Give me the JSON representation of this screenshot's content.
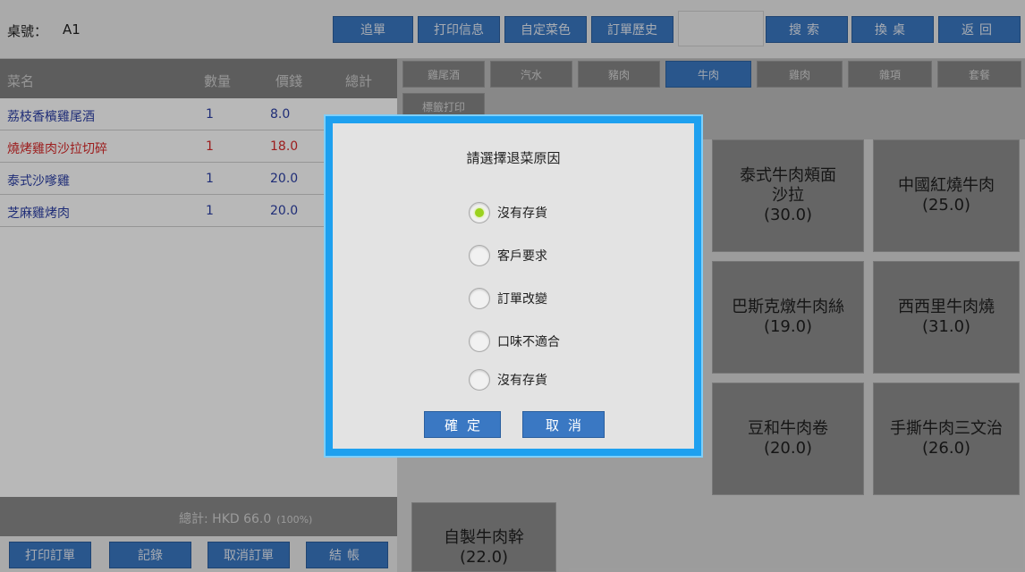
{
  "topbar": {
    "table_label": "桌號：",
    "table_value": "A1",
    "buttons": {
      "add_order": "追單",
      "print_info": "打印信息",
      "custom_color": "自定菜色",
      "order_history": "訂單歷史",
      "search": "搜索",
      "change_table": "換桌",
      "back": "返回"
    },
    "search_value": ""
  },
  "order": {
    "headers": {
      "name": "菜名",
      "qty": "數量",
      "price": "價錢",
      "total": "總計"
    },
    "rows": [
      {
        "name": "荔枝香檳雞尾酒",
        "qty": "1",
        "price": "8.0",
        "color": "#2b3fa6"
      },
      {
        "name": "燒烤雞肉沙拉切碎",
        "qty": "1",
        "price": "18.0",
        "color": "#d92a2a"
      },
      {
        "name": "泰式沙嗲雞",
        "qty": "1",
        "price": "20.0",
        "color": "#2b3fa6"
      },
      {
        "name": "芝麻雞烤肉",
        "qty": "1",
        "price": "20.0",
        "color": "#2b3fa6"
      }
    ],
    "total_text": "總計: HKD 66.0",
    "total_pct": "(100%)"
  },
  "bottom_buttons": {
    "print_order": "打印訂單",
    "record": "記錄",
    "cancel_order": "取消訂單",
    "checkout": "結帳"
  },
  "categories": [
    {
      "label": "雞尾酒",
      "active": false
    },
    {
      "label": "汽水",
      "active": false
    },
    {
      "label": "豬肉",
      "active": false
    },
    {
      "label": "牛肉",
      "active": true
    },
    {
      "label": "雞肉",
      "active": false
    },
    {
      "label": "雜項",
      "active": false
    },
    {
      "label": "套餐",
      "active": false
    }
  ],
  "sub_category": "標籤打印",
  "dishes": [
    {
      "name": "泰式牛肉頰面沙拉",
      "price": "(30.0)"
    },
    {
      "name": "中國紅燒牛肉",
      "price": "(25.0)"
    },
    {
      "name": "巴斯克燉牛肉絲",
      "price": "(19.0)"
    },
    {
      "name": "西西里牛肉燒",
      "price": "(31.0)"
    },
    {
      "name": "豆和牛肉卷",
      "price": "(20.0)"
    },
    {
      "name": "手撕牛肉三文治",
      "price": "(26.0)"
    },
    {
      "name": "自製牛肉幹",
      "price": "(22.0)"
    }
  ],
  "modal": {
    "title": "請選擇退菜原因",
    "options": [
      {
        "label": "沒有存貨",
        "selected": true
      },
      {
        "label": "客戶要求",
        "selected": false
      },
      {
        "label": "訂單改變",
        "selected": false
      },
      {
        "label": "口味不適合",
        "selected": false
      },
      {
        "label": "沒有存貨",
        "selected": false
      }
    ],
    "confirm": "確定",
    "cancel": "取消"
  }
}
